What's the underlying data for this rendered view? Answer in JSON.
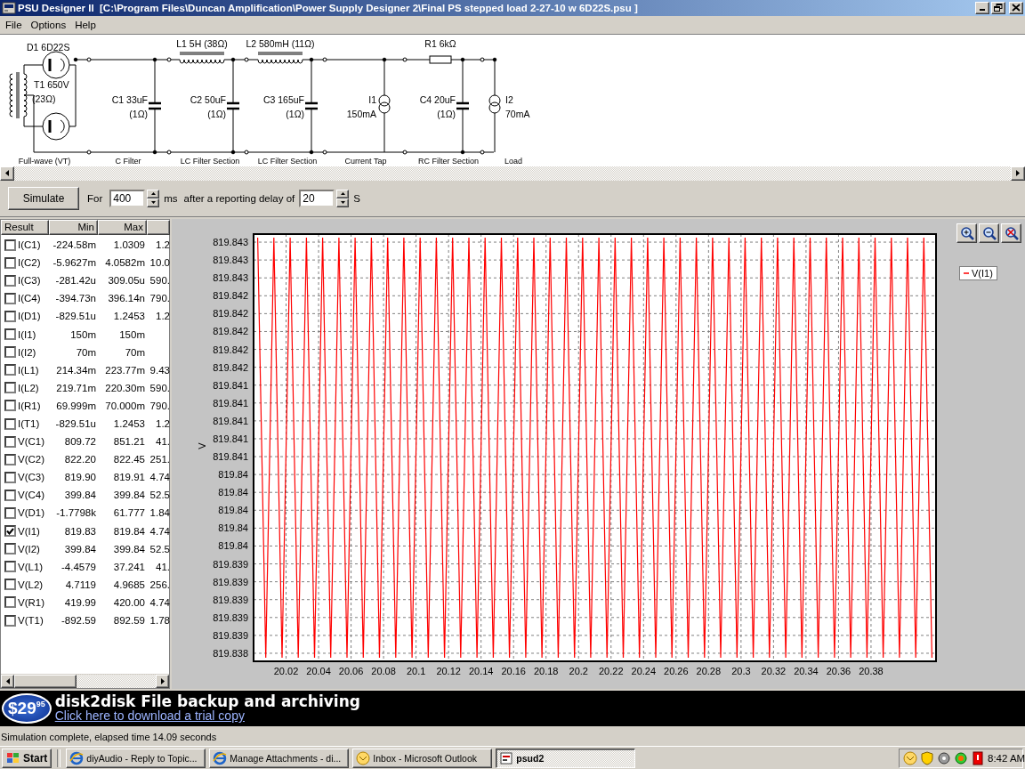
{
  "window": {
    "title": "PSU Designer II  [C:\\Program Files\\Duncan Amplification\\Power Supply Designer 2\\Final PS stepped load 2-27-10 w 6D22S.psu ]"
  },
  "menu": [
    "File",
    "Options",
    "Help"
  ],
  "schematic": {
    "sections": [
      {
        "kind": "rectifier",
        "caption": "Full-wave (VT)",
        "labels": [
          "D1 6D22S",
          "T1 650V",
          "(23Ω)"
        ]
      },
      {
        "kind": "c_filter",
        "caption": "C Filter",
        "labels": [
          "C1 33uF",
          "(1Ω)"
        ]
      },
      {
        "kind": "lc_filter",
        "caption": "LC Filter Section",
        "labels": [
          "L1 5H (38Ω)",
          "C2 50uF",
          "(1Ω)"
        ]
      },
      {
        "kind": "lc_filter",
        "caption": "LC Filter Section",
        "labels": [
          "L2 580mH (11Ω)",
          "C3 165uF",
          "(1Ω)"
        ]
      },
      {
        "kind": "current_tap",
        "caption": "Current Tap",
        "labels": [
          "I1",
          "150mA"
        ]
      },
      {
        "kind": "rc_filter",
        "caption": "RC Filter Section",
        "labels": [
          "R1 6kΩ",
          "C4 20uF",
          "(1Ω)"
        ]
      },
      {
        "kind": "load",
        "caption": "Load",
        "labels": [
          "I2",
          "70mA"
        ]
      }
    ]
  },
  "simulation": {
    "button": "Simulate",
    "for_label": "For",
    "duration": "400",
    "duration_unit": "ms",
    "delay_label": "after a reporting delay of",
    "delay": "20",
    "delay_unit": "S"
  },
  "results": {
    "columns": [
      "Result",
      "Min",
      "Max"
    ],
    "rows": [
      {
        "name": "I(C1)",
        "min": "-224.58m",
        "max": "1.0309",
        "column_4": "1.2",
        "checked": false
      },
      {
        "name": "I(C2)",
        "min": "-5.9627m",
        "max": "4.0582m",
        "column_4": "10.0",
        "checked": false
      },
      {
        "name": "I(C3)",
        "min": "-281.42u",
        "max": "309.05u",
        "column_4": "590.",
        "checked": false
      },
      {
        "name": "I(C4)",
        "min": "-394.73n",
        "max": "396.14n",
        "column_4": "790.",
        "checked": false
      },
      {
        "name": "I(D1)",
        "min": "-829.51u",
        "max": "1.2453",
        "column_4": "1.2",
        "checked": false
      },
      {
        "name": "I(I1)",
        "min": "150m",
        "max": "150m",
        "checked": false
      },
      {
        "name": "I(I2)",
        "min": "70m",
        "max": "70m",
        "checked": false
      },
      {
        "name": "I(L1)",
        "min": "214.34m",
        "max": "223.77m",
        "column_4": "9.43",
        "checked": false
      },
      {
        "name": "I(L2)",
        "min": "219.71m",
        "max": "220.30m",
        "column_4": "590.",
        "checked": false
      },
      {
        "name": "I(R1)",
        "min": "69.999m",
        "max": "70.000m",
        "column_4": "790.",
        "checked": false
      },
      {
        "name": "I(T1)",
        "min": "-829.51u",
        "max": "1.2453",
        "column_4": "1.2",
        "checked": false
      },
      {
        "name": "V(C1)",
        "min": "809.72",
        "max": "851.21",
        "column_4": "41.",
        "checked": false
      },
      {
        "name": "V(C2)",
        "min": "822.20",
        "max": "822.45",
        "column_4": "251.",
        "checked": false
      },
      {
        "name": "V(C3)",
        "min": "819.90",
        "max": "819.91",
        "column_4": "4.74",
        "checked": false
      },
      {
        "name": "V(C4)",
        "min": "399.84",
        "max": "399.84",
        "column_4": "52.5",
        "checked": false
      },
      {
        "name": "V(D1)",
        "min": "-1.7798k",
        "max": "61.777",
        "column_4": "1.84",
        "checked": false
      },
      {
        "name": "V(I1)",
        "min": "819.83",
        "max": "819.84",
        "column_4": "4.74",
        "checked": true
      },
      {
        "name": "V(I2)",
        "min": "399.84",
        "max": "399.84",
        "column_4": "52.5",
        "checked": false
      },
      {
        "name": "V(L1)",
        "min": "-4.4579",
        "max": "37.241",
        "column_4": "41.",
        "checked": false
      },
      {
        "name": "V(L2)",
        "min": "4.7119",
        "max": "4.9685",
        "column_4": "256.",
        "checked": false
      },
      {
        "name": "V(R1)",
        "min": "419.99",
        "max": "420.00",
        "column_4": "4.74",
        "checked": false
      },
      {
        "name": "V(T1)",
        "min": "-892.59",
        "max": "892.59",
        "column_4": "1.78",
        "checked": false
      }
    ]
  },
  "chart": {
    "chart_data": {
      "type": "line",
      "ylabel": "V",
      "grid": true,
      "xlim": [
        20.0,
        20.42
      ],
      "ylim": [
        819.83831,
        819.84309
      ],
      "xticks": [
        20.02,
        20.04,
        20.06,
        20.08,
        20.1,
        20.12,
        20.14,
        20.16,
        20.18,
        20.2,
        20.22,
        20.24,
        20.26,
        20.28,
        20.3,
        20.32,
        20.34,
        20.36,
        20.38
      ],
      "yticks": [
        {
          "value": 819.8384,
          "label": "819.838"
        },
        {
          "value": 819.8386,
          "label": "819.839"
        },
        {
          "value": 819.8388,
          "label": "819.839"
        },
        {
          "value": 819.839,
          "label": "819.839"
        },
        {
          "value": 819.8392,
          "label": "819.839"
        },
        {
          "value": 819.8394,
          "label": "819.839"
        },
        {
          "value": 819.8396,
          "label": "819.84"
        },
        {
          "value": 819.8398,
          "label": "819.84"
        },
        {
          "value": 819.84,
          "label": "819.84"
        },
        {
          "value": 819.8402,
          "label": "819.84"
        },
        {
          "value": 819.8404,
          "label": "819.84"
        },
        {
          "value": 819.8406,
          "label": "819.841"
        },
        {
          "value": 819.8408,
          "label": "819.841"
        },
        {
          "value": 819.841,
          "label": "819.841"
        },
        {
          "value": 819.8412,
          "label": "819.841"
        },
        {
          "value": 819.8414,
          "label": "819.841"
        },
        {
          "value": 819.8416,
          "label": "819.842"
        },
        {
          "value": 819.8418,
          "label": "819.842"
        },
        {
          "value": 819.842,
          "label": "819.842"
        },
        {
          "value": 819.8422,
          "label": "819.842"
        },
        {
          "value": 819.8424,
          "label": "819.842"
        },
        {
          "value": 819.8426,
          "label": "819.843"
        },
        {
          "value": 819.8428,
          "label": "819.843"
        },
        {
          "value": 819.843,
          "label": "819.843"
        }
      ],
      "x": [
        20.0025,
        20.0075,
        20.0125,
        20.0175,
        20.0225,
        20.0275,
        20.0325,
        20.0375,
        20.0425,
        20.0475,
        20.0525,
        20.0575,
        20.0625,
        20.0675,
        20.0725,
        20.0775,
        20.0825,
        20.0875,
        20.0925,
        20.0975,
        20.1025,
        20.1075,
        20.1125,
        20.1175,
        20.1225,
        20.1275,
        20.1325,
        20.1375,
        20.1425,
        20.1475,
        20.1525,
        20.1575,
        20.1625,
        20.1675,
        20.1725,
        20.1775,
        20.1825,
        20.1875,
        20.1925,
        20.1975,
        20.2025,
        20.2075,
        20.2125,
        20.2175,
        20.2225,
        20.2275,
        20.2325,
        20.2375,
        20.2425,
        20.2475,
        20.2525,
        20.2575,
        20.2625,
        20.2675,
        20.2725,
        20.2775,
        20.2825,
        20.2875,
        20.2925,
        20.2975,
        20.3025,
        20.3075,
        20.3125,
        20.3175,
        20.3225,
        20.3275,
        20.3325,
        20.3375,
        20.3425,
        20.3475,
        20.3525,
        20.3575,
        20.3625,
        20.3675,
        20.3725,
        20.3775,
        20.3825,
        20.3875,
        20.3925,
        20.3975,
        20.4025,
        20.4075,
        20.4125,
        20.4175
      ],
      "series": [
        {
          "name": "V(I1)",
          "color": "#ff0000",
          "values": [
            819.84305,
            819.83835,
            819.84305,
            819.83835,
            819.84305,
            819.83835,
            819.84305,
            819.83835,
            819.84305,
            819.83835,
            819.84305,
            819.83835,
            819.84305,
            819.83835,
            819.84305,
            819.83835,
            819.84305,
            819.83835,
            819.84305,
            819.83835,
            819.84305,
            819.83835,
            819.84305,
            819.83835,
            819.84305,
            819.83835,
            819.84305,
            819.83835,
            819.84305,
            819.83835,
            819.84305,
            819.83835,
            819.84305,
            819.83835,
            819.84305,
            819.83835,
            819.84305,
            819.83835,
            819.84305,
            819.83835,
            819.84305,
            819.83835,
            819.84305,
            819.83835,
            819.84305,
            819.83835,
            819.84305,
            819.83835,
            819.84305,
            819.83835,
            819.84305,
            819.83835,
            819.84305,
            819.83835,
            819.84305,
            819.83835,
            819.84305,
            819.83835,
            819.84305,
            819.83835,
            819.84305,
            819.83835,
            819.84305,
            819.83835,
            819.84305,
            819.83835,
            819.84305,
            819.83835,
            819.84305,
            819.83835,
            819.84305,
            819.83835,
            819.84305,
            819.83835,
            819.84305,
            819.83835,
            819.84305,
            819.83835,
            819.84305,
            819.83835,
            819.84305,
            819.83835,
            819.84305,
            819.83835
          ]
        }
      ]
    }
  },
  "banner": {
    "price": "$29",
    "price_cents": "95",
    "title": "disk2disk File backup and archiving",
    "link": "Click here to download a trial copy"
  },
  "status_bar": "Simulation complete, elapsed time 14.09 seconds",
  "taskbar": {
    "start": "Start",
    "tasks": [
      {
        "kind": "browser",
        "label": "diyAudio - Reply to Topic...",
        "selected": false
      },
      {
        "kind": "browser",
        "label": "Manage Attachments - di...",
        "selected": false
      },
      {
        "kind": "mail",
        "label": "Inbox - Microsoft Outlook",
        "selected": false
      },
      {
        "kind": "app",
        "label": "psud2",
        "selected": true
      }
    ],
    "clock": "8:42 AM"
  }
}
